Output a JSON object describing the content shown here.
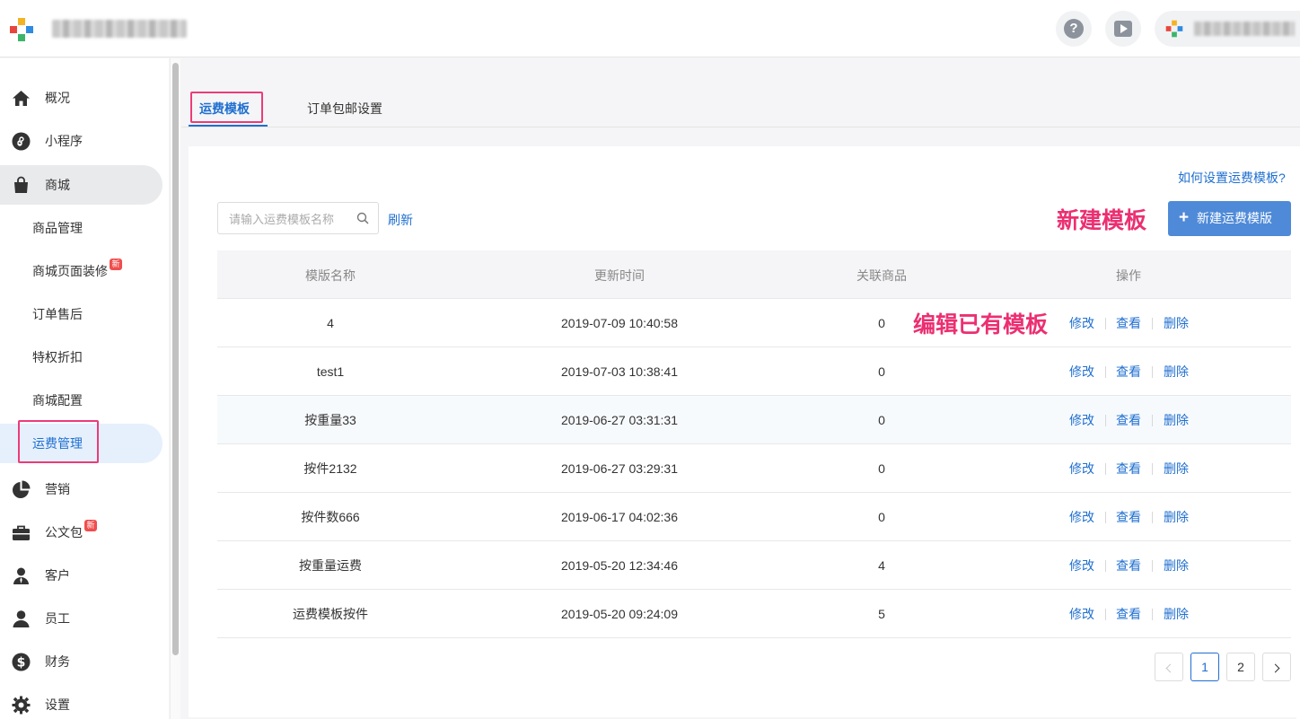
{
  "header": {
    "help_glyph": "?"
  },
  "sidebar": {
    "items": [
      {
        "label": "概况",
        "icon": "home-icon"
      },
      {
        "label": "小程序",
        "icon": "miniprogram-icon"
      },
      {
        "label": "商城",
        "icon": "shopping-bag-icon"
      },
      {
        "label": "营销",
        "icon": "pie-chart-icon"
      },
      {
        "label": "公文包",
        "icon": "briefcase-icon",
        "badge": "新"
      },
      {
        "label": "客户",
        "icon": "customer-icon"
      },
      {
        "label": "员工",
        "icon": "user-icon"
      },
      {
        "label": "财务",
        "icon": "dollar-icon"
      },
      {
        "label": "设置",
        "icon": "gear-icon"
      }
    ],
    "mall_sub": [
      {
        "label": "商品管理"
      },
      {
        "label": "商城页面装修",
        "badge": "新"
      },
      {
        "label": "订单售后"
      },
      {
        "label": "特权折扣"
      },
      {
        "label": "商城配置"
      },
      {
        "label": "运费管理"
      }
    ]
  },
  "tabs": [
    {
      "label": "运费模板"
    },
    {
      "label": "订单包邮设置"
    }
  ],
  "toolbar": {
    "help_link": "如何设置运费模板?",
    "search_placeholder": "请输入运费模板名称",
    "refresh": "刷新",
    "new_button": "新建运费模版",
    "plus": "+"
  },
  "annotations": {
    "new_template": "新建模板",
    "edit_existing": "编辑已有模板"
  },
  "table": {
    "headers": [
      "模版名称",
      "更新时间",
      "关联商品",
      "操作"
    ],
    "actions": [
      "修改",
      "查看",
      "删除"
    ],
    "rows": [
      {
        "name": "4",
        "updated": "2019-07-09 10:40:58",
        "products": "0"
      },
      {
        "name": "test1",
        "updated": "2019-07-03 10:38:41",
        "products": "0"
      },
      {
        "name": "按重量33",
        "updated": "2019-06-27 03:31:31",
        "products": "0"
      },
      {
        "name": "按件2132",
        "updated": "2019-06-27 03:29:31",
        "products": "0"
      },
      {
        "name": "按件数666",
        "updated": "2019-06-17 04:02:36",
        "products": "0"
      },
      {
        "name": "按重量运费",
        "updated": "2019-05-20 12:34:46",
        "products": "4"
      },
      {
        "name": "运费模板按件",
        "updated": "2019-05-20 09:24:09",
        "products": "5"
      }
    ]
  },
  "pagination": {
    "pages": [
      "1",
      "2"
    ],
    "current": "1"
  },
  "colors": {
    "accent": "#1f6fd0",
    "primary_button": "#4f8ad8",
    "highlight": "#ec3b78",
    "badge": "#f04d4d"
  }
}
